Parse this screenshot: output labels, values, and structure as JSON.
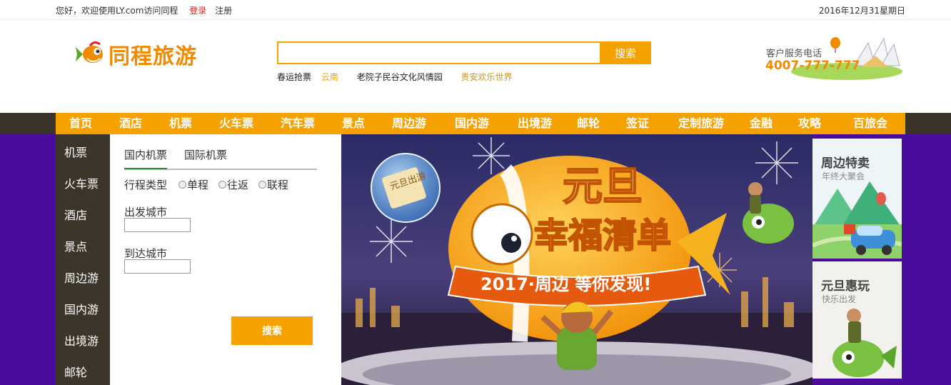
{
  "topbar": {
    "welcome": "您好，欢迎使用LY.com访问同程",
    "login": "登录",
    "register": "注册",
    "date": "2016年12月31星期日"
  },
  "logo": {
    "text": "同程旅游"
  },
  "search": {
    "value": "",
    "button_label": "搜索"
  },
  "hot_links": [
    "春运抢票",
    "云南",
    "老院子民谷文化风情园",
    "贵安欢乐世界"
  ],
  "service": {
    "label": "客户服务电话",
    "phone": "4007-777-777"
  },
  "nav": [
    "首页",
    "酒店",
    "机票",
    "火车票",
    "汽车票",
    "景点",
    "周边游",
    "国内游",
    "出境游",
    "邮轮",
    "签证",
    "定制旅游",
    "金融",
    "攻略",
    "百旅会"
  ],
  "sidebar": [
    "机票",
    "火车票",
    "酒店",
    "景点",
    "周边游",
    "国内游",
    "出境游",
    "邮轮"
  ],
  "booking": {
    "tabs": [
      "国内机票",
      "国际机票"
    ],
    "trip_type_label": "行程类型",
    "trip_types": [
      "单程",
      "往返",
      "联程"
    ],
    "from_label": "出发城市",
    "to_label": "到达城市",
    "from_value": "",
    "to_value": "",
    "button_label": "搜索"
  },
  "banner": {
    "title_top": "元旦",
    "title_bottom": "幸福清单",
    "slogan": "2017·周边  等你发现!",
    "bubble_text": "元旦出游"
  },
  "promos": [
    {
      "title": "周边特卖",
      "subtitle": "年终大聚会"
    },
    {
      "title": "元旦惠玩",
      "subtitle": "快乐出发"
    }
  ],
  "colors": {
    "accent": "#f5a100",
    "nav_dark": "#3a3327",
    "purple_bg": "#4b0c9b",
    "login_red": "#e2231a"
  }
}
